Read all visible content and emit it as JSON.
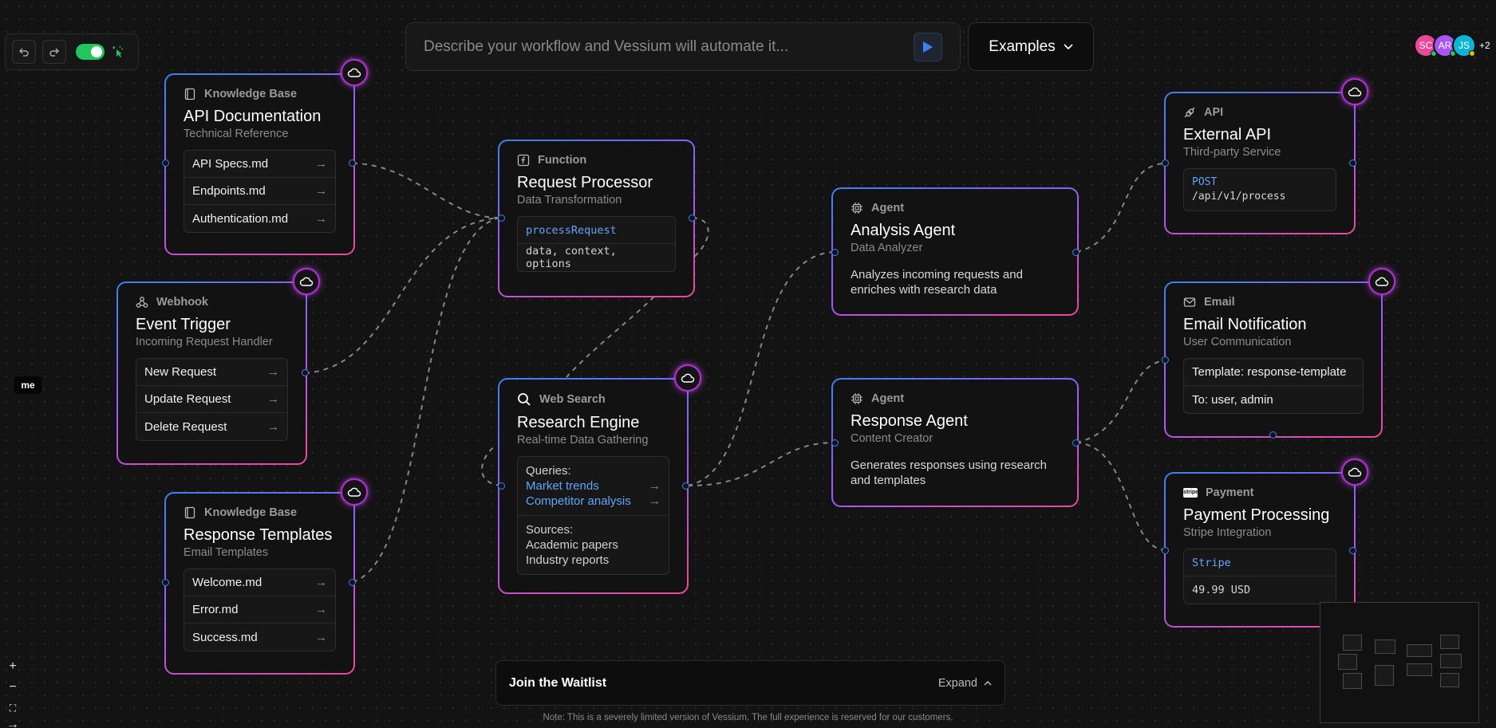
{
  "toolbar": {
    "undo_icon": "undo-icon",
    "redo_icon": "redo-icon",
    "toggle_state": "on",
    "cursor_icon": "sparkle-cursor-icon"
  },
  "prompt": {
    "placeholder": "Describe your workflow and Vessium will automate it...",
    "value": ""
  },
  "examples": {
    "label": "Examples"
  },
  "avatars": [
    {
      "initials": "SC",
      "color": "#ec4899",
      "status": "#22c55e"
    },
    {
      "initials": "AR",
      "color": "#a855f7",
      "status": "#22c55e"
    },
    {
      "initials": "JS",
      "color": "#06b6d4",
      "status": "#eab308"
    }
  ],
  "avatars_more": "+2",
  "nodes": {
    "api_docs": {
      "type": "Knowledge Base",
      "title": "API Documentation",
      "subtitle": "Technical Reference",
      "items": [
        "API Specs.md",
        "Endpoints.md",
        "Authentication.md"
      ]
    },
    "event_trigger": {
      "type": "Webhook",
      "title": "Event Trigger",
      "subtitle": "Incoming Request Handler",
      "items": [
        "New Request",
        "Update Request",
        "Delete Request"
      ]
    },
    "response_templates": {
      "type": "Knowledge Base",
      "title": "Response Templates",
      "subtitle": "Email Templates",
      "items": [
        "Welcome.md",
        "Error.md",
        "Success.md"
      ]
    },
    "request_processor": {
      "type": "Function",
      "title": "Request Processor",
      "subtitle": "Data Transformation",
      "fn_name": "processRequest",
      "fn_args": "data, context, options"
    },
    "research_engine": {
      "type": "Web Search",
      "title": "Research Engine",
      "subtitle": "Real-time Data Gathering",
      "queries_label": "Queries:",
      "queries": [
        "Market trends",
        "Competitor analysis"
      ],
      "sources_label": "Sources:",
      "sources": [
        "Academic papers",
        "Industry reports"
      ]
    },
    "analysis_agent": {
      "type": "Agent",
      "title": "Analysis Agent",
      "subtitle": "Data Analyzer",
      "description": "Analyzes incoming requests and enriches with research data"
    },
    "response_agent": {
      "type": "Agent",
      "title": "Response Agent",
      "subtitle": "Content Creator",
      "description": "Generates responses using research and templates"
    },
    "external_api": {
      "type": "API",
      "title": "External API",
      "subtitle": "Third-party Service",
      "method": "POST",
      "endpoint": "/api/v1/process"
    },
    "email_notification": {
      "type": "Email",
      "title": "Email Notification",
      "subtitle": "User Communication",
      "template": "Template: response-template",
      "to": "To: user, admin"
    },
    "payment_processing": {
      "type": "Payment",
      "title": "Payment Processing",
      "subtitle": "Stripe Integration",
      "provider": "Stripe",
      "amount": "49.99 USD"
    }
  },
  "waitlist": {
    "title": "Join the Waitlist",
    "expand_label": "Expand"
  },
  "note": "Note: This is a severely limited version of Vessium. The full experience is reserved for our customers.",
  "me_label": "me",
  "zoom": {
    "in": "+",
    "out": "−",
    "fit": "⛶",
    "next": "→"
  },
  "colors": {
    "accent_blue": "#3b82f6",
    "accent_purple": "#a855f7",
    "accent_pink": "#ec4899",
    "toggle_green": "#22c55e"
  }
}
